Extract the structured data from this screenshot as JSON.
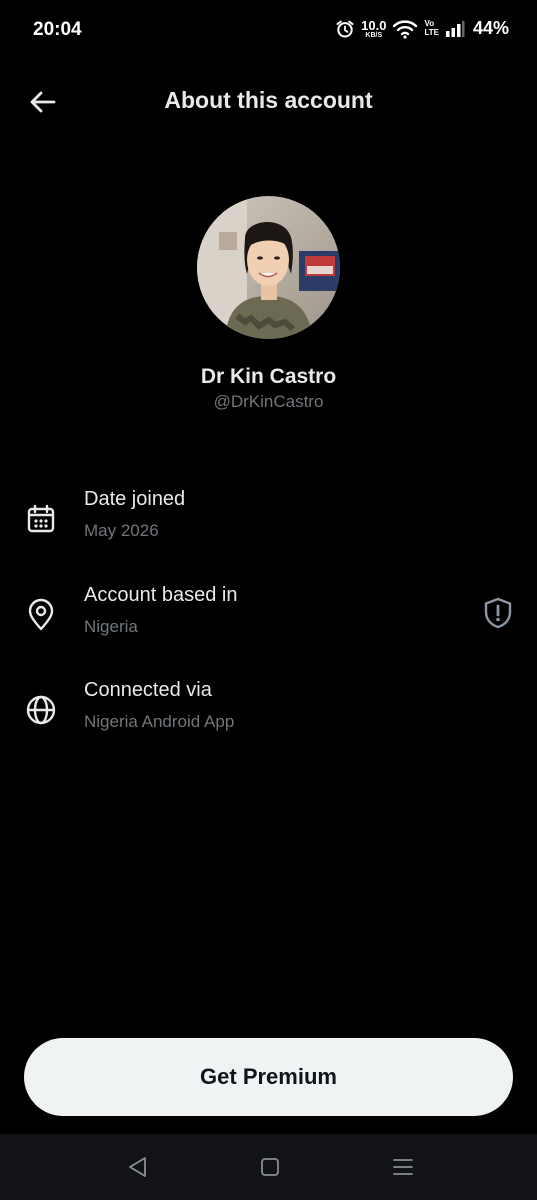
{
  "status_bar": {
    "time": "20:04",
    "net_speed_value": "10.0",
    "net_speed_unit": "KB/S",
    "volte_top": "Vo",
    "volte_bottom": "LTE",
    "battery": "44%",
    "icons": [
      "alarm-icon",
      "wifi-icon",
      "signal-icon"
    ]
  },
  "header": {
    "title": "About this account",
    "back_icon": "arrow-left-icon"
  },
  "profile": {
    "display_name": "Dr Kin Castro",
    "handle": "@DrKinCastro"
  },
  "info_rows": [
    {
      "icon": "calendar-icon",
      "label": "Date joined",
      "value": "May 2026"
    },
    {
      "icon": "location-pin-icon",
      "label": "Account based in",
      "value": "Nigeria",
      "badge_icon": "shield-alert-icon"
    },
    {
      "icon": "globe-icon",
      "label": "Connected via",
      "value": "Nigeria Android App"
    }
  ],
  "cta": {
    "label": "Get Premium"
  },
  "nav_bar": {
    "icons": [
      "nav-back-icon",
      "nav-home-icon",
      "nav-menu-icon"
    ]
  },
  "colors": {
    "background": "#000000",
    "primary_text": "#e7e9ea",
    "secondary_text": "#71767b",
    "button_bg": "#eff3f4",
    "button_text": "#0f1419"
  }
}
